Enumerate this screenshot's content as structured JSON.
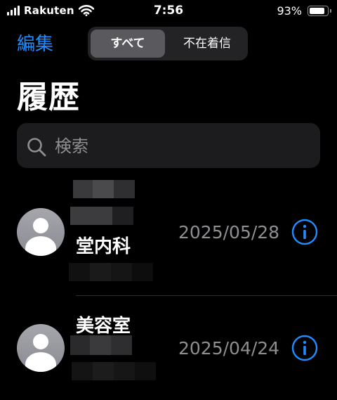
{
  "status_bar": {
    "carrier": "Rakuten",
    "time": "7:56",
    "battery_percent": "93%",
    "battery_level": 0.93
  },
  "header": {
    "edit_label": "編集",
    "segments": [
      {
        "label": "すべて",
        "selected": true
      },
      {
        "label": "不在着信",
        "selected": false
      }
    ],
    "title": "履歴"
  },
  "search": {
    "placeholder": "検索",
    "value": ""
  },
  "calls": [
    {
      "name": "堂内科",
      "date": "2025/05/28"
    },
    {
      "name": "美容室",
      "date": "2025/04/24"
    }
  ],
  "colors": {
    "accent": "#1f8cff",
    "background": "#000000",
    "secondary_text": "#8e8e93",
    "search_background": "#1c1c1e"
  },
  "icons": [
    "signal-icon",
    "wifi-icon",
    "battery-icon",
    "search-icon",
    "contact-avatar-icon",
    "info-icon"
  ]
}
